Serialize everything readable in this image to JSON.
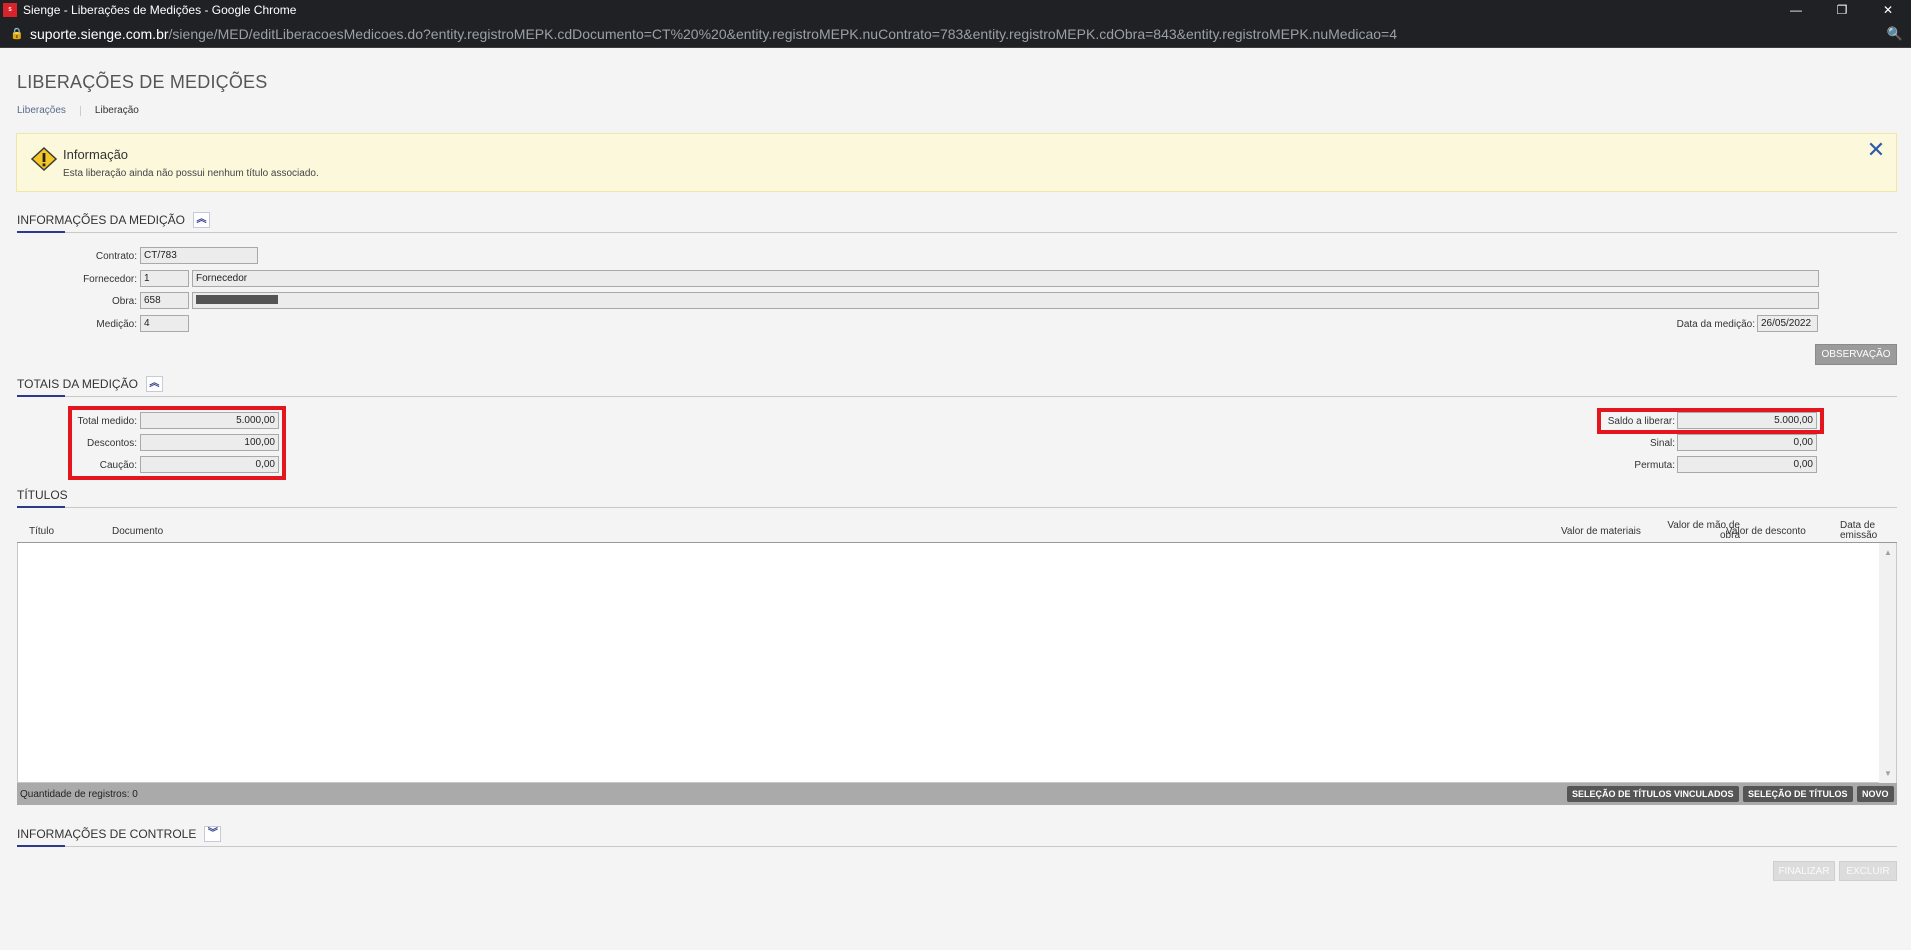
{
  "window": {
    "app_logo_text": "Sienge",
    "title": "Sienge -  Liberações de Medições - Google Chrome",
    "minimize": "—",
    "restore": "❐",
    "close": "✕"
  },
  "address_bar": {
    "host": "suporte.sienge.com.br",
    "path": "/sienge/MED/editLiberacoesMedicoes.do?entity.registroMEPK.cdDocumento=CT%20%20&entity.registroMEPK.nuContrato=783&entity.registroMEPK.cdObra=843&entity.registroMEPK.nuMedicao=4",
    "lock_icon": "🔒",
    "zoom_icon": "🔍"
  },
  "page": {
    "title": "LIBERAÇÕES DE MEDIÇÕES",
    "breadcrumb": {
      "link": "Liberações",
      "current": "Liberação"
    }
  },
  "alert": {
    "icon": "warning-icon",
    "title": "Informação",
    "text": "Esta liberação ainda não possui nenhum título associado.",
    "close": "✕"
  },
  "info_section": {
    "title": "INFORMAÇÕES DA MEDIÇÃO",
    "toggle": "︽",
    "contrato_label": "Contrato:",
    "contrato_value": "CT/783",
    "fornecedor_label": "Fornecedor:",
    "fornecedor_code": "1",
    "fornecedor_name": "Fornecedor",
    "obra_label": "Obra:",
    "obra_code": "658",
    "medicao_label": "Medição:",
    "medicao_value": "4",
    "data_label": "Data da medição:",
    "data_value": "26/05/2022",
    "observacao_button": "OBSERVAÇÃO"
  },
  "totals_section": {
    "title": "TOTAIS DA MEDIÇÃO",
    "toggle": "︽",
    "total_medido_label": "Total medido:",
    "total_medido_value": "5.000,00",
    "descontos_label": "Descontos:",
    "descontos_value": "100,00",
    "caucao_label": "Caução:",
    "caucao_value": "0,00",
    "saldo_label": "Saldo a liberar:",
    "saldo_value": "5.000,00",
    "sinal_label": "Sinal:",
    "sinal_value": "0,00",
    "permuta_label": "Permuta:",
    "permuta_value": "0,00"
  },
  "titles_section": {
    "title": "TÍTULOS",
    "columns": {
      "titulo": "Título",
      "documento": "Documento",
      "valor_materiais": "Valor de materiais",
      "valor_mao_obra_1": "Valor de mão de",
      "valor_mao_obra_2": "obra",
      "valor_desconto": "Valor de desconto",
      "data_emissao_1": "Data de",
      "data_emissao_2": "emissão"
    },
    "record_count": "Quantidade de registros: 0",
    "buttons": {
      "vinculados": "SELEÇÃO DE TÍTULOS VINCULADOS",
      "selecao": "SELEÇÃO DE TÍTULOS",
      "novo": "NOVO"
    }
  },
  "control_section": {
    "title": "INFORMAÇÕES DE CONTROLE",
    "toggle": "︾"
  },
  "footer_buttons": {
    "finalizar": "FINALIZAR",
    "excluir": "EXCLUIR"
  },
  "colors": {
    "accent": "#2d3a8c",
    "highlight": "#e3161e",
    "alert_bg": "#fcf8dc"
  }
}
